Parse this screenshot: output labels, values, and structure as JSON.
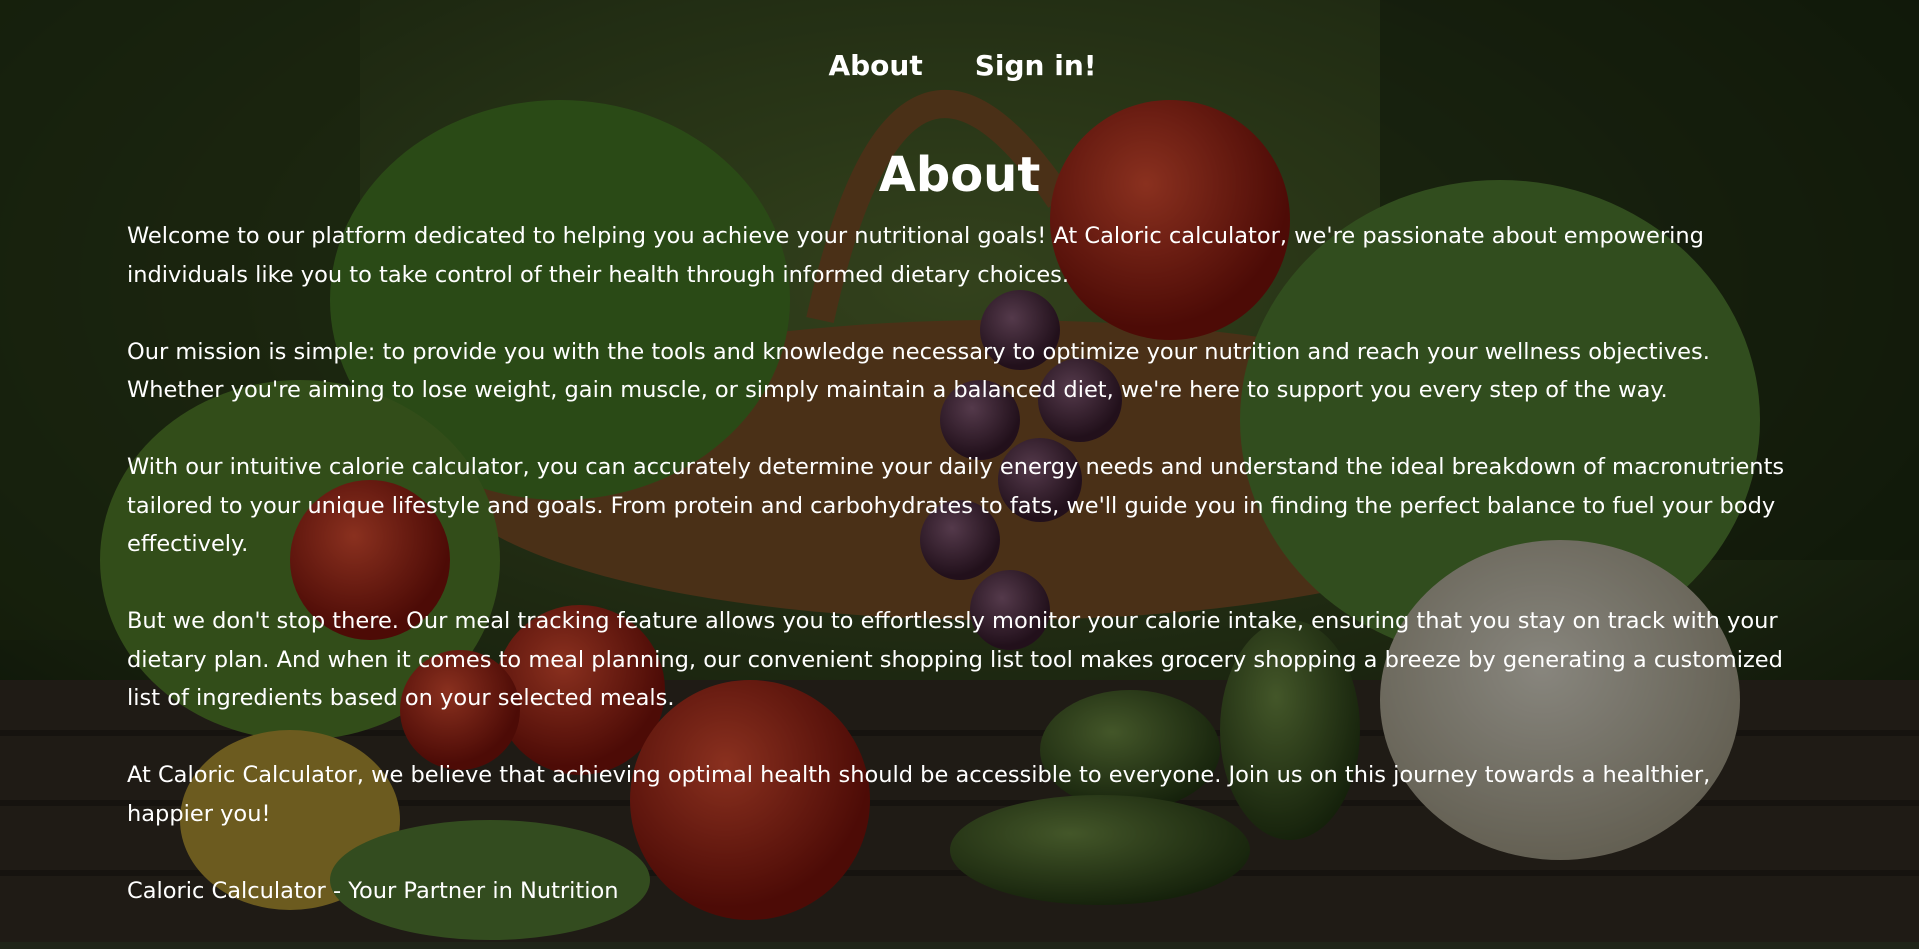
{
  "nav": {
    "about_label": "About",
    "signin_label": "Sign in!"
  },
  "page": {
    "title": "About",
    "paragraphs": [
      "Welcome to our platform dedicated to helping you achieve your nutritional goals! At Caloric calculator, we're passionate about empowering individuals like you to take control of their health through informed dietary choices.",
      "Our mission is simple: to provide you with the tools and knowledge necessary to optimize your nutrition and reach your wellness objectives. Whether you're aiming to lose weight, gain muscle, or simply maintain a balanced diet, we're here to support you every step of the way.",
      "With our intuitive calorie calculator, you can accurately determine your daily energy needs and understand the ideal breakdown of macronutrients tailored to your unique lifestyle and goals. From protein and carbohydrates to fats, we'll guide you in finding the perfect balance to fuel your body effectively.",
      "But we don't stop there. Our meal tracking feature allows you to effortlessly monitor your calorie intake, ensuring that you stay on track with your dietary plan. And when it comes to meal planning, our convenient shopping list tool makes grocery shopping a breeze by generating a customized list of ingredients based on your selected meals.",
      "At Caloric Calculator, we believe that achieving optimal health should be accessible to everyone. Join us on this journey towards a healthier, happier you!",
      "Caloric Calculator - Your Partner in Nutrition"
    ]
  }
}
